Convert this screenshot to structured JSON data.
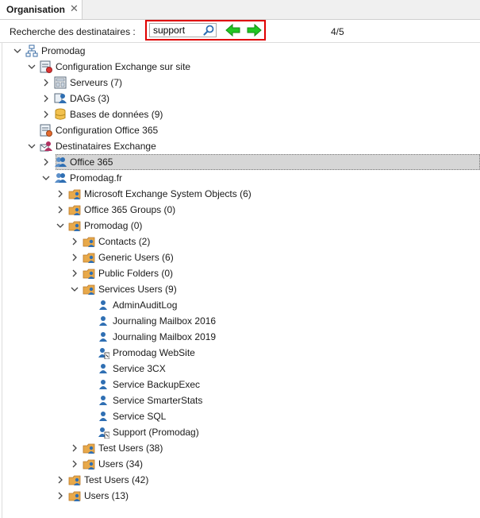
{
  "tab": {
    "title": "Organisation",
    "close_glyph": "✕"
  },
  "search": {
    "label": "Recherche des destinataires :",
    "value": "support",
    "result_counter": "4/5",
    "icons": {
      "search": "search-icon",
      "previous": "arrow-left-icon",
      "next": "arrow-right-icon"
    }
  },
  "colors": {
    "highlight_border": "#e00000",
    "nav_arrow": "#22c722",
    "selection": "#d6d6d6",
    "folder": "#e8a94a",
    "user": "#2f6fb3"
  },
  "tree": [
    {
      "label": "Promodag",
      "icon": "organization-icon",
      "toggle": "expanded"
    },
    {
      "label": "Configuration Exchange sur site",
      "icon": "server-config-icon",
      "toggle": "expanded"
    },
    {
      "label": "Serveurs (7)",
      "icon": "server-icon",
      "toggle": "collapsed"
    },
    {
      "label": "DAGs (3)",
      "icon": "dag-icon",
      "toggle": "collapsed"
    },
    {
      "label": "Bases de données (9)",
      "icon": "database-icon",
      "toggle": "collapsed"
    },
    {
      "label": "Configuration Office 365",
      "icon": "cloud-config-icon",
      "toggle": "none"
    },
    {
      "label": "Destinataires Exchange",
      "icon": "recipients-icon",
      "toggle": "expanded"
    },
    {
      "label": "Office 365",
      "icon": "users-group-icon",
      "toggle": "collapsed",
      "selected": true
    },
    {
      "label": "Promodag.fr",
      "icon": "users-group-icon",
      "toggle": "expanded"
    },
    {
      "label": "Microsoft Exchange System Objects (6)",
      "icon": "user-folder-icon",
      "toggle": "collapsed"
    },
    {
      "label": "Office 365 Groups (0)",
      "icon": "user-folder-icon",
      "toggle": "collapsed"
    },
    {
      "label": "Promodag (0)",
      "icon": "user-folder-icon",
      "toggle": "expanded"
    },
    {
      "label": "Contacts (2)",
      "icon": "user-folder-icon",
      "toggle": "collapsed"
    },
    {
      "label": "Generic Users (6)",
      "icon": "user-folder-icon",
      "toggle": "collapsed"
    },
    {
      "label": "Public Folders (0)",
      "icon": "user-folder-icon",
      "toggle": "collapsed"
    },
    {
      "label": "Services Users (9)",
      "icon": "user-folder-icon",
      "toggle": "expanded"
    },
    {
      "label": "AdminAuditLog",
      "icon": "user-icon",
      "toggle": "none"
    },
    {
      "label": "Journaling Mailbox 2016",
      "icon": "user-icon",
      "toggle": "none"
    },
    {
      "label": "Journaling Mailbox 2019",
      "icon": "user-icon",
      "toggle": "none"
    },
    {
      "label": "Promodag WebSite",
      "icon": "user-disabled-icon",
      "toggle": "none"
    },
    {
      "label": "Service 3CX",
      "icon": "user-icon",
      "toggle": "none"
    },
    {
      "label": "Service BackupExec",
      "icon": "user-icon",
      "toggle": "none"
    },
    {
      "label": "Service SmarterStats",
      "icon": "user-icon",
      "toggle": "none"
    },
    {
      "label": "Service SQL",
      "icon": "user-icon",
      "toggle": "none"
    },
    {
      "label": "Support (Promodag)",
      "icon": "user-disabled-icon",
      "toggle": "none"
    },
    {
      "label": "Test Users (38)",
      "icon": "user-folder-icon",
      "toggle": "collapsed"
    },
    {
      "label": "Users (34)",
      "icon": "user-folder-icon",
      "toggle": "collapsed"
    },
    {
      "label": "Test Users (42)",
      "icon": "user-folder-icon",
      "toggle": "collapsed"
    },
    {
      "label": "Users (13)",
      "icon": "user-folder-icon",
      "toggle": "collapsed"
    }
  ]
}
